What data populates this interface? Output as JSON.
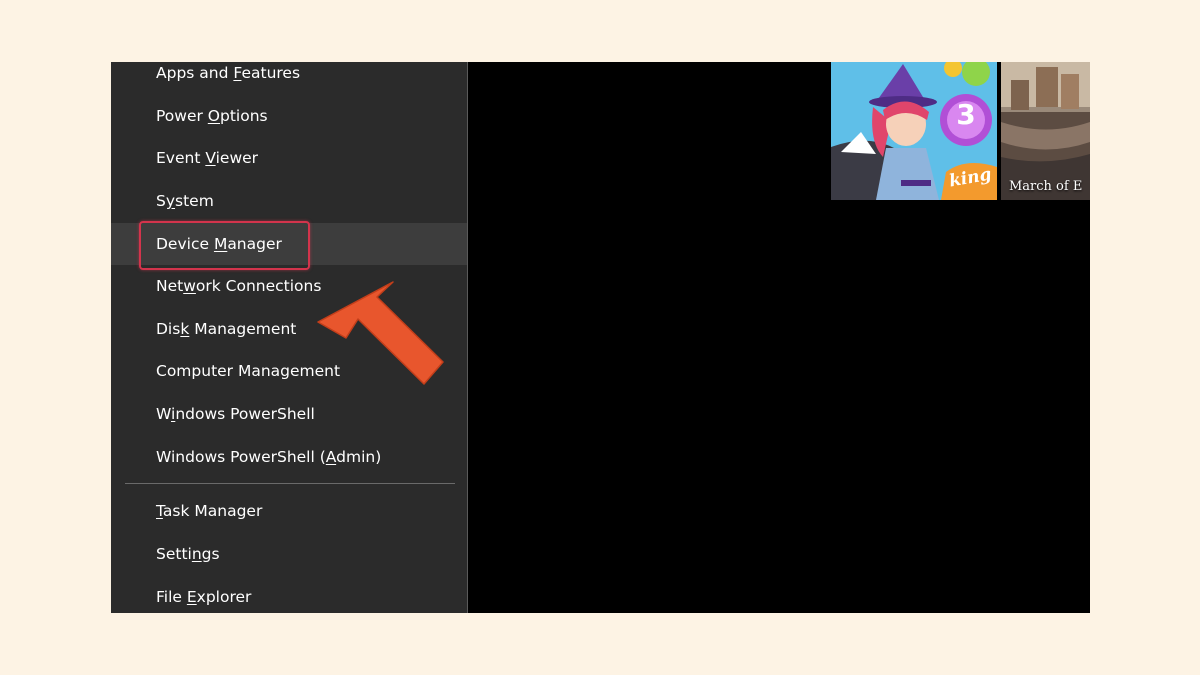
{
  "menu": {
    "items": [
      {
        "pre": "Apps and ",
        "mn": "F",
        "post": "eatures"
      },
      {
        "pre": "Power ",
        "mn": "O",
        "post": "ptions"
      },
      {
        "pre": "Event ",
        "mn": "V",
        "post": "iewer"
      },
      {
        "pre": "S",
        "mn": "y",
        "post": "stem"
      },
      {
        "pre": "Device ",
        "mn": "M",
        "post": "anager"
      },
      {
        "pre": "Net",
        "mn": "w",
        "post": "ork Connections"
      },
      {
        "pre": "Dis",
        "mn": "k",
        "post": " Management"
      },
      {
        "pre": "Computer Management",
        "mn": "",
        "post": ""
      },
      {
        "pre": "W",
        "mn": "i",
        "post": "ndows PowerShell"
      },
      {
        "pre": "Windows PowerShell (",
        "mn": "A",
        "post": "dmin)"
      },
      {
        "pre": "",
        "mn": "T",
        "post": "ask Manager"
      },
      {
        "pre": "Setti",
        "mn": "n",
        "post": "gs"
      },
      {
        "pre": "File ",
        "mn": "E",
        "post": "xplorer"
      }
    ]
  },
  "tiles": {
    "tile1_badge": "3",
    "tile1_logo": "king",
    "tile2_caption": "March of E"
  },
  "colors": {
    "menu_bg": "#2b2b2b",
    "highlight_border": "#d3344c",
    "arrow": "#e8562d",
    "page_bg": "#fdf3e4"
  }
}
